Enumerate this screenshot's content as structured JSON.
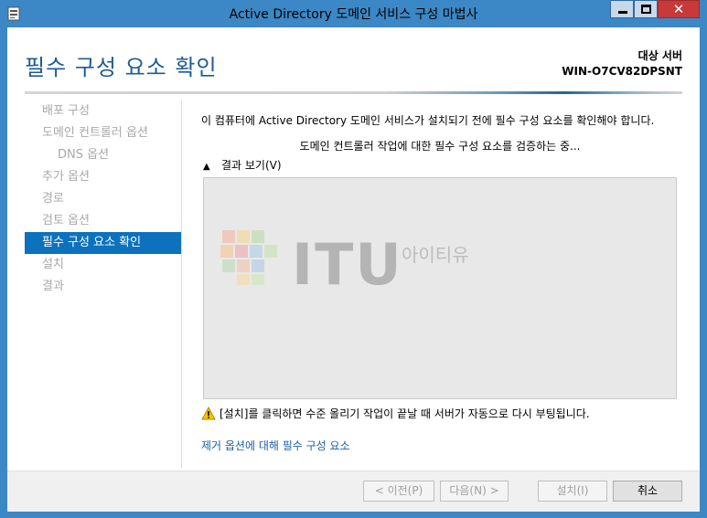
{
  "window": {
    "title": "Active Directory 도메인 서비스 구성 마법사",
    "close_glyph": "✕"
  },
  "header": {
    "page_title": "필수 구성 요소 확인",
    "target_label": "대상 서버",
    "target_server": "WIN-O7CV82DPSNT"
  },
  "nav": {
    "items": [
      {
        "label": "배포 구성"
      },
      {
        "label": "도메인 컨트롤러 옵션"
      },
      {
        "label": "DNS 옵션"
      },
      {
        "label": "추가 옵션"
      },
      {
        "label": "경로"
      },
      {
        "label": "검토 옵션"
      },
      {
        "label": "필수 구성 요소 확인"
      },
      {
        "label": "설치"
      },
      {
        "label": "결과"
      }
    ],
    "active_index": 6
  },
  "main": {
    "intro": "이 컴퓨터에 Active Directory 도메인 서비스가 설치되기 전에 필수 구성 요소를 확인해야 합니다.",
    "status": "도메인 컨트롤러 작업에 대한 필수 구성 요소를 검증하는 중...",
    "results_toggle": "결과 보기(V)",
    "watermark": {
      "brand": "ITU",
      "sub": "아이티유"
    },
    "warning": "[설치]를 클릭하면 수준 올리기 작업이 끝날 때 서버가 자동으로 다시 부팅됩니다.",
    "link": "제거 옵션에 대해 필수 구성 요소"
  },
  "buttons": {
    "prev": "< 이전(P)",
    "next": "다음(N) >",
    "install": "설치(I)",
    "cancel": "취소"
  },
  "colors": {
    "titlebar": "#3c87c5",
    "accent": "#0d72bd",
    "title_text": "#1e5b94",
    "link": "#1d5fa5"
  }
}
